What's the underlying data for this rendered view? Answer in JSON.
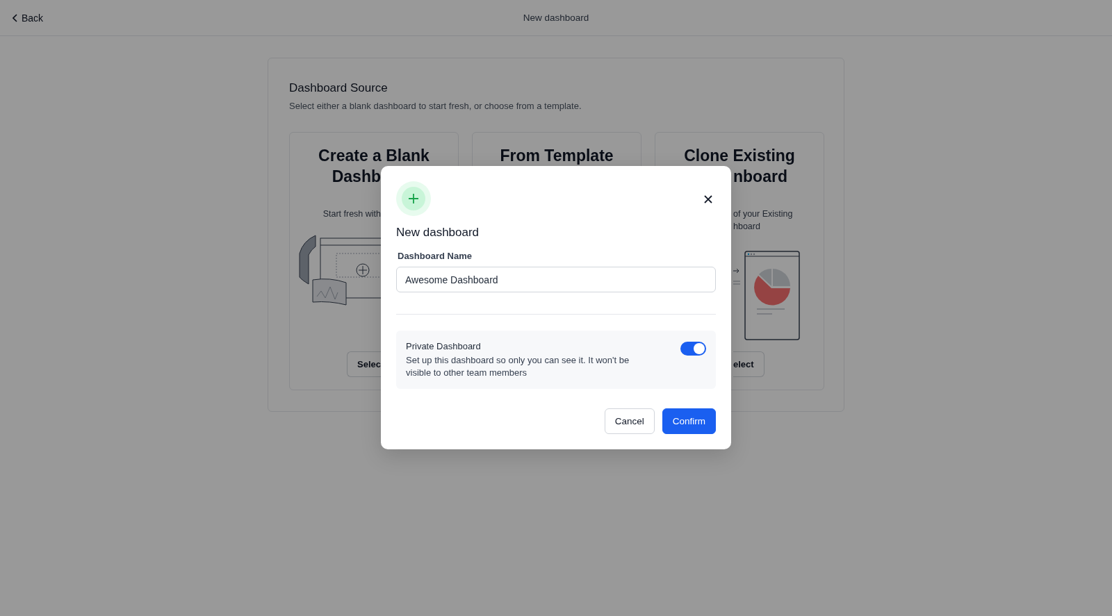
{
  "top_bar": {
    "back": "Back",
    "title": "New dashboard"
  },
  "source": {
    "title": "Dashboard Source",
    "subtitle": "Select either a blank dashboard to start fresh, or choose from a template.",
    "cards": [
      {
        "kind": "covered_right",
        "title_lines": [
          "Create a Blank",
          "Dashb"
        ],
        "description_lines": [
          "Start fresh with"
        ],
        "button": "Selec"
      },
      {
        "kind": "covered_below",
        "title_lines": [
          "From Template"
        ]
      },
      {
        "kind": "covered_left",
        "title_lines": [
          "Clone Existing",
          "nboard"
        ],
        "description_lines": [
          "of your Existing",
          "hboard"
        ],
        "button": "elect"
      }
    ]
  },
  "modal": {
    "title": "New dashboard",
    "name_label": "Dashboard Name",
    "name_value": "Awesome Dashboard",
    "private": {
      "label": "Private Dashboard",
      "description": "Set up this dashboard so only you can see it. It won't be visible to other team members",
      "on": true
    },
    "buttons": [
      {
        "label": "Cancel",
        "kind": "secondary"
      },
      {
        "label": "Confirm",
        "kind": "primary"
      }
    ]
  }
}
